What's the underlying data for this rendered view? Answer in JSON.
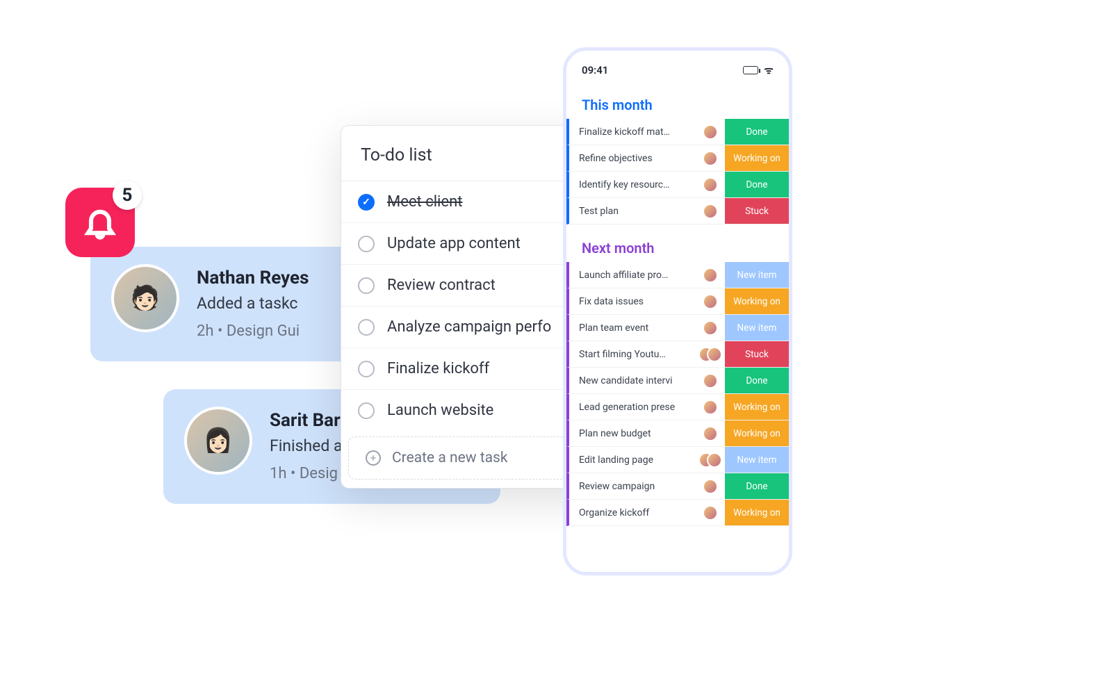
{
  "bell": {
    "count": "5"
  },
  "notifications": [
    {
      "name": "Nathan Reyes",
      "desc": "Added a taskc",
      "meta": "2h • Design Gui",
      "emoji": "🧑🏻"
    },
    {
      "name": "Sarit Bar",
      "desc": "Finished a",
      "meta": "1h • Desig",
      "emoji": "👩🏻"
    }
  ],
  "todo": {
    "title": "To-do list",
    "items": [
      {
        "label": "Meet client",
        "done": true
      },
      {
        "label": "Update app content",
        "done": false
      },
      {
        "label": "Review contract",
        "done": false
      },
      {
        "label": "Analyze campaign perfo",
        "done": false
      },
      {
        "label": "Finalize kickoff",
        "done": false
      },
      {
        "label": "Launch website",
        "done": false
      }
    ],
    "create_label": "Create a new task"
  },
  "phone": {
    "time": "09:41",
    "groups": {
      "this": {
        "title": "This month",
        "rows": [
          {
            "name": "Finalize kickoff mat…",
            "avatars": 1,
            "status": "Done",
            "cls": "s-done"
          },
          {
            "name": "Refine objectives",
            "avatars": 1,
            "status": "Working on",
            "cls": "s-working"
          },
          {
            "name": "Identify key resourc…",
            "avatars": 1,
            "status": "Done",
            "cls": "s-done"
          },
          {
            "name": "Test plan",
            "avatars": 1,
            "status": "Stuck",
            "cls": "s-stuck"
          }
        ]
      },
      "next": {
        "title": "Next month",
        "rows": [
          {
            "name": "Launch affiliate pro…",
            "avatars": 1,
            "status": "New item",
            "cls": "s-new"
          },
          {
            "name": "Fix data issues",
            "avatars": 1,
            "status": "Working on",
            "cls": "s-working"
          },
          {
            "name": "Plan team event",
            "avatars": 1,
            "status": "New item",
            "cls": "s-new"
          },
          {
            "name": "Start filming Youtu…",
            "avatars": 2,
            "status": "Stuck",
            "cls": "s-stuck"
          },
          {
            "name": "New candidate intervi",
            "avatars": 1,
            "status": "Done",
            "cls": "s-done"
          },
          {
            "name": "Lead generation prese",
            "avatars": 1,
            "status": "Working on",
            "cls": "s-working"
          },
          {
            "name": "Plan new budget",
            "avatars": 1,
            "status": "Working on",
            "cls": "s-working"
          },
          {
            "name": "Edit landing page",
            "avatars": 2,
            "status": "New item",
            "cls": "s-new"
          },
          {
            "name": "Review campaign",
            "avatars": 1,
            "status": "Done",
            "cls": "s-done"
          },
          {
            "name": "Organize kickoff",
            "avatars": 1,
            "status": "Working on",
            "cls": "s-working"
          }
        ]
      }
    }
  }
}
